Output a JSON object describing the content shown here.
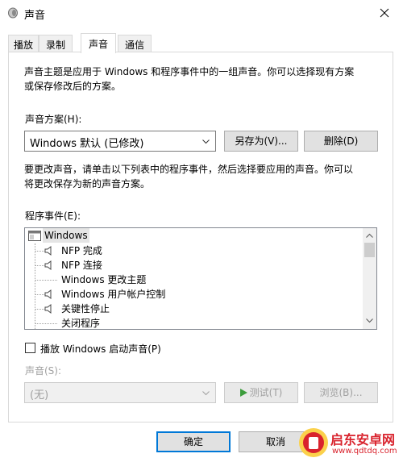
{
  "window": {
    "title": "声音",
    "close_icon": "close-icon",
    "app_icon": "speaker-icon"
  },
  "tabs": [
    {
      "label": "播放",
      "active": false
    },
    {
      "label": "录制",
      "active": false
    },
    {
      "label": "声音",
      "active": true
    },
    {
      "label": "通信",
      "active": false
    }
  ],
  "intro": {
    "line1": "声音主题是应用于 Windows 和程序事件中的一组声音。你可以选择现有方案",
    "line2": "或保存修改后的方案。"
  },
  "scheme": {
    "label": "声音方案(H):",
    "selected": "Windows 默认 (已修改)",
    "save_as_label": "另存为(V)...",
    "delete_label": "删除(D)"
  },
  "instructions": {
    "line1": "要更改声音，请单击以下列表中的程序事件，然后选择要应用的声音。你可以",
    "line2": "将更改保存为新的声音方案。"
  },
  "events": {
    "label": "程序事件(E):",
    "root": "Windows",
    "items": [
      {
        "label": "NFP 完成",
        "has_sound": true
      },
      {
        "label": "NFP 连接",
        "has_sound": true
      },
      {
        "label": "Windows 更改主题",
        "has_sound": false
      },
      {
        "label": "Windows 用户帐户控制",
        "has_sound": true
      },
      {
        "label": "关键性停止",
        "has_sound": true
      },
      {
        "label": "关闭程序",
        "has_sound": false
      }
    ]
  },
  "startup": {
    "label": "播放 Windows 启动声音(P)",
    "checked": false
  },
  "sound": {
    "label": "声音(S):",
    "selected": "(无)",
    "test_label": "测试(T)",
    "browse_label": "浏览(B)..."
  },
  "footer": {
    "ok_label": "确定",
    "cancel_label": "取消"
  },
  "watermark": {
    "text": "启东安卓网",
    "url": "www.qdtdq.com"
  },
  "colors": {
    "accent": "#0078d7",
    "watermark": "#d9232d",
    "disabled": "#a0a0a0"
  }
}
